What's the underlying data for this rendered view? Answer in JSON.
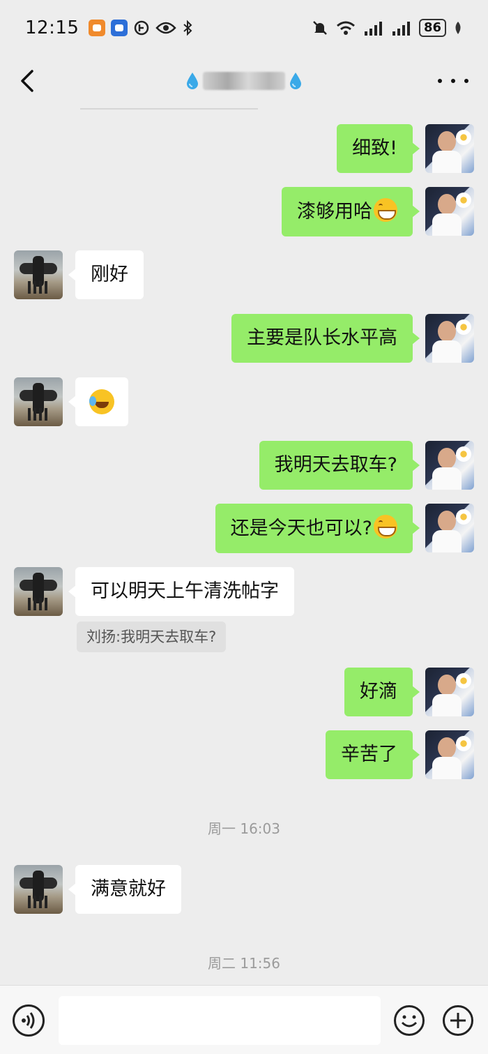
{
  "status_bar": {
    "time": "12:15",
    "battery": "86",
    "icons": [
      "orange-app-icon",
      "blue-app-icon",
      "data-saver-icon",
      "eye-icon",
      "bluetooth-icon",
      "mute-icon",
      "wifi-icon",
      "signal-icon",
      "leaf-icon"
    ]
  },
  "header": {
    "icons": [
      "back-icon",
      "water-drop-icon",
      "more-icon"
    ]
  },
  "messages": [
    {
      "side": "right",
      "text": "细致!"
    },
    {
      "side": "right",
      "text": "漆够用哈",
      "emoji": "grin"
    },
    {
      "side": "left",
      "text": "刚好"
    },
    {
      "side": "right",
      "text": "主要是队长水平高"
    },
    {
      "side": "left",
      "text": "",
      "emoji": "laugh-cry"
    },
    {
      "side": "right",
      "text": "我明天去取车?"
    },
    {
      "side": "right",
      "text": "还是今天也可以?",
      "emoji": "grin"
    },
    {
      "side": "left",
      "text": "可以明天上午清洗帖字",
      "quote": "刘扬:我明天去取车?"
    },
    {
      "side": "right",
      "text": "好滴"
    },
    {
      "side": "right",
      "text": "辛苦了"
    },
    {
      "side": "left",
      "text": "满意就好"
    }
  ],
  "timestamps": [
    "周一 16:03",
    "周二 11:56"
  ],
  "input_bar": {
    "value": "",
    "icons": [
      "voice-icon",
      "emoji-icon",
      "plus-icon"
    ]
  },
  "colors": {
    "background": "#ededed",
    "bubble_self": "#95ec69",
    "bubble_other": "#ffffff"
  }
}
